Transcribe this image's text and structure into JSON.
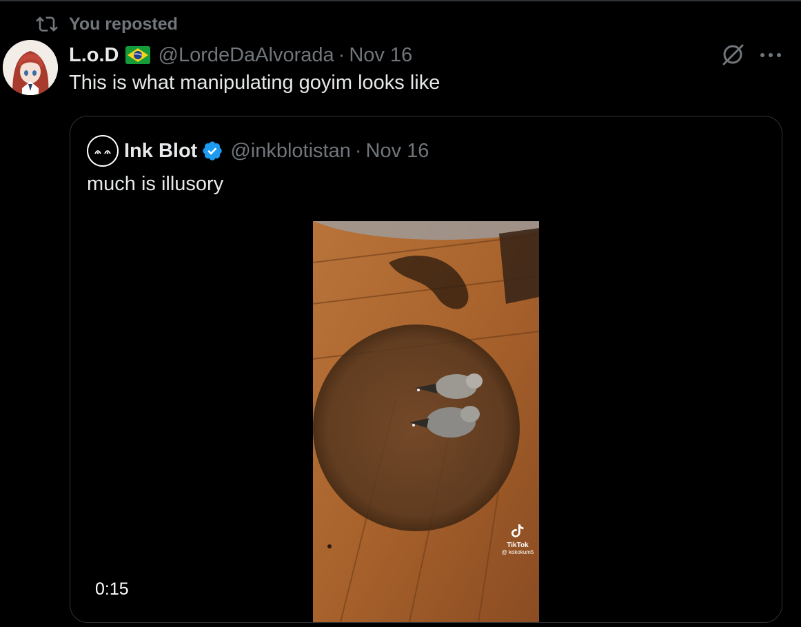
{
  "repost": {
    "label": "You reposted",
    "icon": "repost-icon"
  },
  "post": {
    "display_name": "L.o.D",
    "flag": "brazil-flag-icon",
    "handle": "@LordeDaAlvorada",
    "separator": "·",
    "date": "Nov 16",
    "text": "This is what manipulating goyim looks like",
    "actions": [
      "grok-icon",
      "more-options-icon"
    ]
  },
  "quote": {
    "display_name": "Ink Blot",
    "verified": true,
    "handle": "@inkblotistan",
    "separator": "·",
    "date": "Nov 16",
    "text": "much is illusory",
    "video": {
      "duration": "0:15",
      "watermark_label": "TikTok",
      "watermark_user": "@ kokokum5"
    }
  },
  "colors": {
    "background": "#000000",
    "text_primary": "#e7e9ea",
    "text_secondary": "#71767b",
    "border": "#2f3336",
    "verified_blue": "#1d9bf0"
  }
}
